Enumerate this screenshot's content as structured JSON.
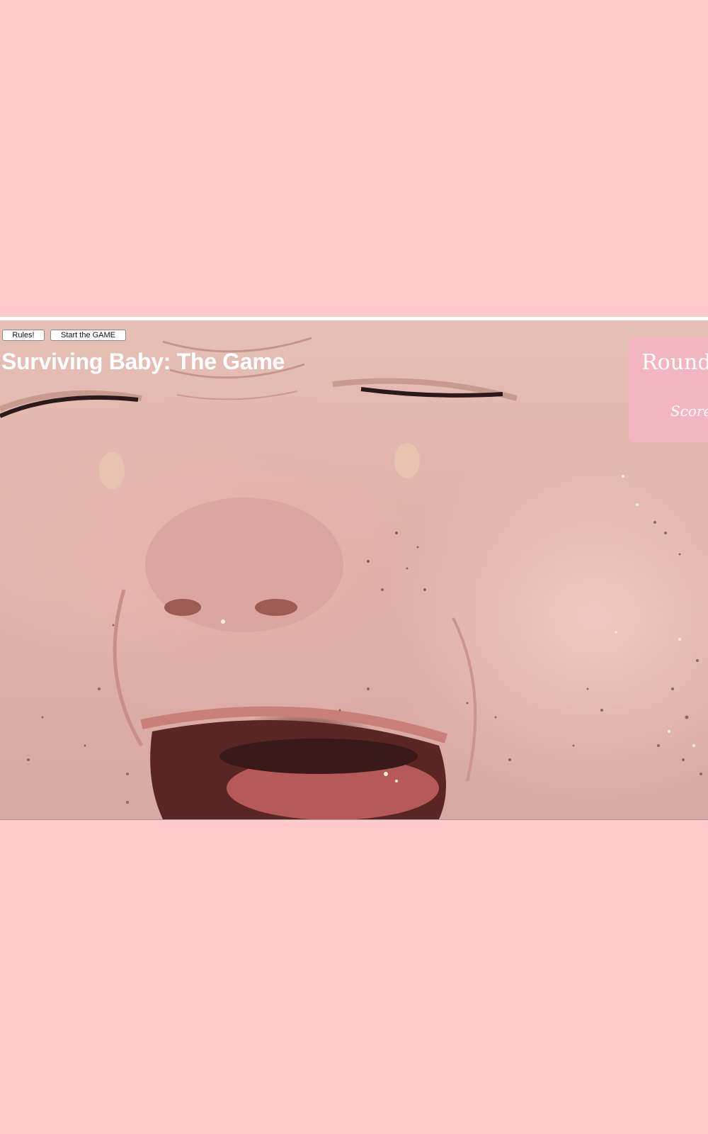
{
  "controls": {
    "rules_label": "Rules!",
    "start_label": "Start the GAME"
  },
  "game": {
    "title": "Surviving Baby: The Game"
  },
  "status": {
    "round_label": "Round",
    "score_label": "Score"
  },
  "colors": {
    "page_background": "#ffcaca",
    "panel_background": "#f3b6c0",
    "text_on_photo": "#ffffff"
  },
  "background_image": {
    "subject": "crying-baby-face-photo"
  }
}
